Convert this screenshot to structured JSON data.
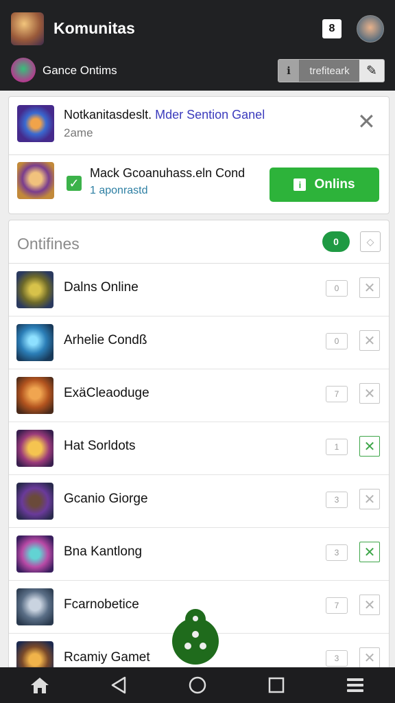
{
  "app": {
    "title": "Komunitas",
    "badge": "8",
    "subtitle": "Gance Ontims",
    "toggle_text": "trefiteark"
  },
  "notifications": [
    {
      "title": "Notkanitasdeslt.",
      "title_accent": "Mder Sention Ganel",
      "subtitle": "2ame"
    },
    {
      "title": "Mack Gcoanuhass.eln Cond",
      "subtitle": "1 aponrastd",
      "button_label": "Onlins"
    }
  ],
  "list": {
    "title": "Ontifines",
    "filter_count": "0",
    "games": [
      {
        "name": "Dalns Online",
        "count": "0",
        "selected": false
      },
      {
        "name": "Arhelie Condß",
        "count": "0",
        "selected": false
      },
      {
        "name": "ExäCleaoduge",
        "count": "7",
        "selected": false
      },
      {
        "name": "Hat Sorldots",
        "count": "1",
        "selected": true
      },
      {
        "name": "Gcanio Giorge",
        "count": "3",
        "selected": false
      },
      {
        "name": "Bna Kantlong",
        "count": "3",
        "selected": true
      },
      {
        "name": "Fcarnobetice",
        "count": "7",
        "selected": false
      },
      {
        "name": "Rcamiy Gamet",
        "count": "3",
        "selected": false
      }
    ]
  },
  "colors": {
    "appbar": "#202123",
    "accent_green": "#2db33a",
    "dark_green": "#1f6b1c",
    "link_purple": "#3b3bbd"
  }
}
